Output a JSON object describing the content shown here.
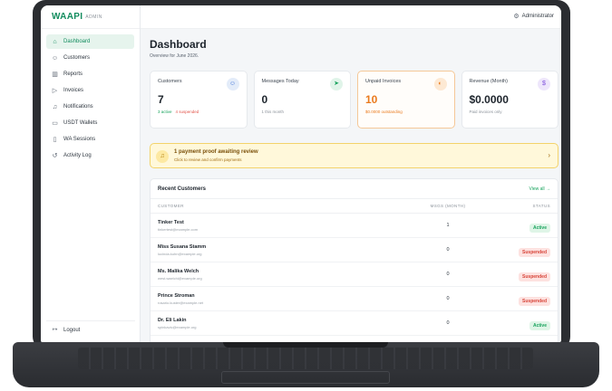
{
  "brand": {
    "name": "WAAPI",
    "sub": "ADMIN"
  },
  "topbar": {
    "user_label": "Administrator",
    "user_icon": "gear-icon"
  },
  "sidebar": {
    "items": [
      {
        "label": "Dashboard",
        "icon": "home-icon",
        "active": true
      },
      {
        "label": "Customers",
        "icon": "users-icon"
      },
      {
        "label": "Reports",
        "icon": "bar-chart-icon"
      },
      {
        "label": "Invoices",
        "icon": "tag-icon"
      },
      {
        "label": "Notifications",
        "icon": "bell-icon"
      },
      {
        "label": "USDT Wallets",
        "icon": "wallet-icon"
      },
      {
        "label": "WA Sessions",
        "icon": "phone-icon"
      },
      {
        "label": "Activity Log",
        "icon": "history-icon"
      }
    ],
    "logout_label": "Logout"
  },
  "page": {
    "title": "Dashboard",
    "subtitle": "Overview for June 2026."
  },
  "stats": [
    {
      "label": "Customers",
      "value": "7",
      "sub_green": "3 active",
      "sub_red": "4 suspended",
      "icon": "users-icon",
      "icon_bg": "#e3ecf9",
      "icon_color": "#3b6fd6"
    },
    {
      "label": "Messages Today",
      "value": "0",
      "sub": "1 this month",
      "icon": "send-icon",
      "icon_bg": "#e0f4e9",
      "icon_color": "#18a35d"
    },
    {
      "label": "Unpaid Invoices",
      "value": "10",
      "sub": "$0.0000 outstanding",
      "icon": "receipt-icon",
      "icon_bg": "#fde9d3",
      "icon_color": "#ea7a1d",
      "highlight": true
    },
    {
      "label": "Revenue (Month)",
      "value": "$0.0000",
      "sub": "Paid invoices only",
      "icon": "dollar-icon",
      "icon_bg": "#eee6fb",
      "icon_color": "#7c4ddb"
    }
  ],
  "alert": {
    "title": "1 payment proof awaiting review",
    "subtitle": "Click to review and confirm payments",
    "icon": "bell-icon"
  },
  "recent_customers": {
    "title": "Recent Customers",
    "view_all": "View all →",
    "columns": [
      "CUSTOMER",
      "MSGS (MONTH)",
      "STATUS"
    ],
    "rows": [
      {
        "name": "Tinker Test",
        "email": "tinkertest@example.com",
        "msgs": "1",
        "status": "Active"
      },
      {
        "name": "Miss Susana Stamm",
        "email": "lucinda.kuhn@example.org",
        "msgs": "0",
        "status": "Suspended"
      },
      {
        "name": "Ms. Malika Welch",
        "email": "west.waelchi@example.org",
        "msgs": "0",
        "status": "Suspended"
      },
      {
        "name": "Prince Stroman",
        "email": "rosario.kuster@example.net",
        "msgs": "0",
        "status": "Suspended"
      },
      {
        "name": "Dr. Eli Lakin",
        "email": "spinkavic@example.org",
        "msgs": "0",
        "status": "Active"
      }
    ]
  }
}
